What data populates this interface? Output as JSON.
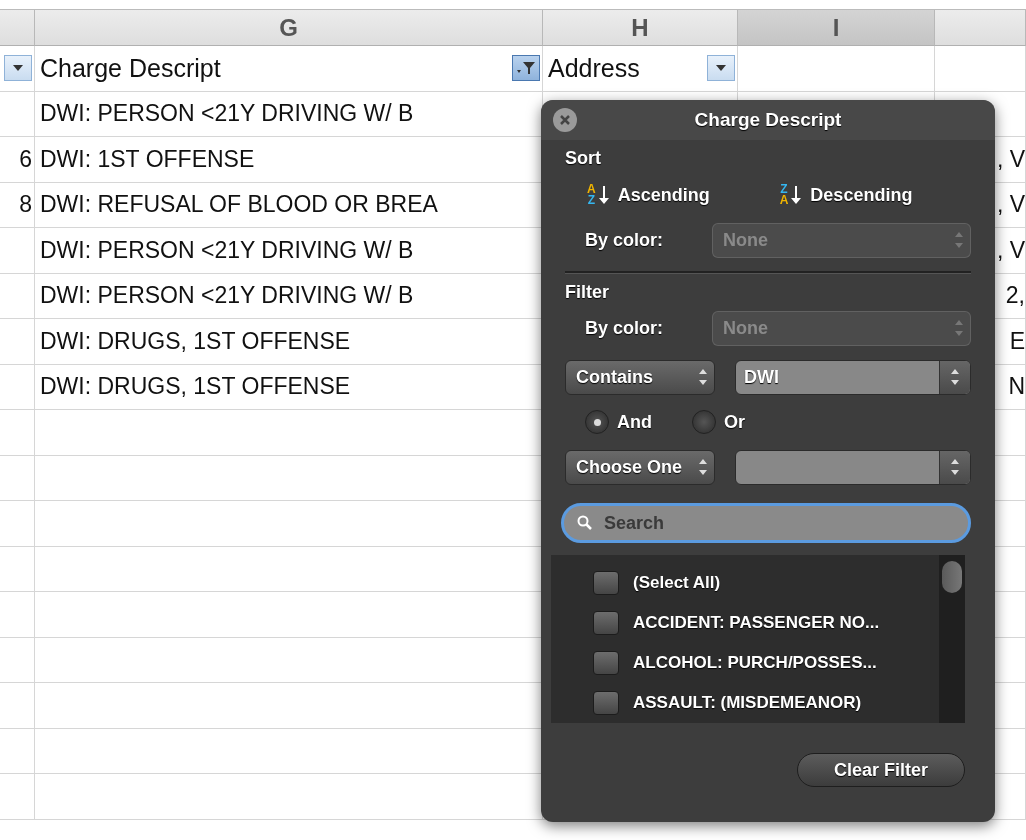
{
  "column_headers": [
    {
      "label": "G",
      "selected": false
    },
    {
      "label": "H",
      "selected": false
    },
    {
      "label": "I",
      "selected": true
    }
  ],
  "table_header": [
    {
      "text": "Charge Descript",
      "filter_active": true
    },
    {
      "text": "Address",
      "filter_active": false
    }
  ],
  "rows": [
    {
      "charge": "DWI: PERSON <21Y DRIVING W/ B"
    },
    {
      "column_f": "6",
      "charge": "DWI: 1ST OFFENSE",
      "column_j": ", V"
    },
    {
      "column_f": "8",
      "charge": "DWI: REFUSAL OF BLOOD OR BREA",
      "column_j": ", V"
    },
    {
      "charge": "DWI: PERSON <21Y DRIVING W/ B",
      "column_j": ", V"
    },
    {
      "charge": "DWI: PERSON <21Y DRIVING W/ B",
      "column_j": "2,"
    },
    {
      "charge": "DWI: DRUGS, 1ST OFFENSE",
      "column_j": "E"
    },
    {
      "charge": "DWI: DRUGS, 1ST OFFENSE",
      "column_j": "N"
    }
  ],
  "filter_popover": {
    "title": "Charge Descript",
    "sort": {
      "heading": "Sort",
      "ascending": {
        "label": "Ascending",
        "icon_top": "A",
        "icon_bottom": "Z"
      },
      "descending": {
        "label": "Descending",
        "icon_top": "Z",
        "icon_bottom": "A"
      },
      "by_color_label": "By color:",
      "by_color_value": "None",
      "by_color_disabled": true
    },
    "filter": {
      "heading": "Filter",
      "by_color_label": "By color:",
      "by_color_value": "None",
      "by_color_disabled": true,
      "condition_1": {
        "operator": "Contains",
        "value": "DWI"
      },
      "joins": [
        {
          "label": "And",
          "selected": true
        },
        {
          "label": "Or",
          "selected": false
        }
      ],
      "condition_2": {
        "operator": "Choose One"
      },
      "search": {
        "placeholder": "Search",
        "focused": true
      },
      "values": [
        {
          "label": "(Select All)",
          "checked": false
        },
        {
          "label": "ACCIDENT: PASSENGER NO...",
          "checked": false
        },
        {
          "label": "ALCOHOL: PURCH/POSSES...",
          "checked": false
        },
        {
          "label": "ASSAULT: (MISDEMEANOR)",
          "checked": false
        }
      ]
    },
    "clear_button": "Clear Filter"
  }
}
